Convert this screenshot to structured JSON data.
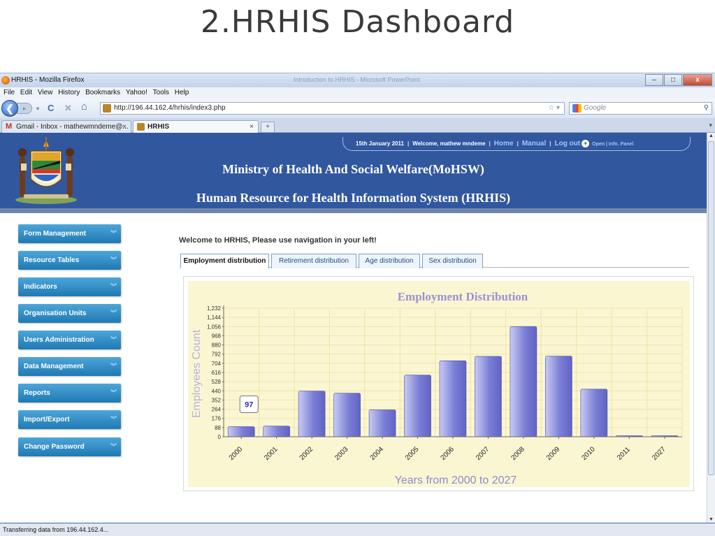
{
  "slide": {
    "title": "2.HRHIS Dashboard"
  },
  "window": {
    "title": "HRHIS - Mozilla Firefox",
    "background_title": "Introduction to HRHIS - Microsoft PowerPoint",
    "buttons": {
      "minimize": "–",
      "maximize": "□",
      "close": "x"
    }
  },
  "menubar": [
    "File",
    "Edit",
    "View",
    "History",
    "Bookmarks",
    "Yahoo!",
    "Tools",
    "Help"
  ],
  "navbar": {
    "back": "❮",
    "forward": "▸",
    "reload": "C",
    "stop": "✕",
    "home": "⌂",
    "url": "http://196.44.162.4/hrhis/index3.php",
    "search_placeholder": "Google"
  },
  "tabs": [
    {
      "label": "Gmail - Inbox - mathewmndeme@...",
      "active": false,
      "close": "×"
    },
    {
      "label": "HRHIS",
      "active": true,
      "close": "×"
    }
  ],
  "newtab": "+",
  "header": {
    "date": "15th January 2011",
    "welcome": "Welcome, mathew mndeme",
    "links": [
      "Home",
      "Manual",
      "Log out"
    ],
    "panel": "Open | Info. Panel",
    "ministry": "Ministry of Health And Social Welfare(MoHSW)",
    "system": "Human Resource for Health Information System (HRHIS)"
  },
  "sidebar": {
    "items": [
      {
        "label": "Form Management"
      },
      {
        "label": "Resource Tables"
      },
      {
        "label": "Indicators"
      },
      {
        "label": "Organisation Units"
      },
      {
        "label": "Users Administration"
      },
      {
        "label": "Data Management"
      },
      {
        "label": "Reports"
      },
      {
        "label": "Import/Export"
      },
      {
        "label": "Change Password"
      }
    ]
  },
  "main": {
    "welcome": "Welcome to HRHIS, Please use navigation in your left!",
    "tabs": [
      {
        "label": "Employment distribution",
        "active": true
      },
      {
        "label": "Retirement distribution",
        "active": false
      },
      {
        "label": "Age distribution",
        "active": false
      },
      {
        "label": "Sex distribution",
        "active": false
      }
    ]
  },
  "chart_data": {
    "type": "bar",
    "title": "Employment Distribution",
    "xlabel": "Years from 2000 to 2027",
    "ylabel": "Employees Count",
    "categories": [
      "2000",
      "2001",
      "2002",
      "2003",
      "2004",
      "2005",
      "2006",
      "2007",
      "2008",
      "2009",
      "2010",
      "2011",
      "2027"
    ],
    "values": [
      97,
      102,
      438,
      418,
      258,
      591,
      728,
      770,
      1056,
      773,
      456,
      4,
      4
    ],
    "yticks": [
      "0",
      "88",
      "176",
      "264",
      "352",
      "440",
      "528",
      "616",
      "704",
      "792",
      "880",
      "968",
      "1,056",
      "1,144",
      "1,232"
    ],
    "ylim": [
      0,
      1232
    ],
    "tooltip": {
      "category": "2000",
      "value": "97"
    },
    "grid": true,
    "bar_color": "#7b7fd6",
    "title_color": "#9a92d4"
  },
  "status": {
    "text": "Transferring data from 196.44.162.4..."
  }
}
